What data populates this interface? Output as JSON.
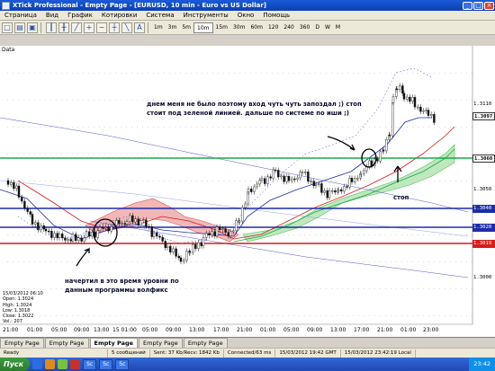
{
  "window": {
    "title": "XTick Professional - Empty Page - [EURUSD, 10 min - Euro vs US Dollar]",
    "minimize": "_",
    "maximize": "□",
    "close": "×"
  },
  "menu": [
    "Страница",
    "Вид",
    "График",
    "Котировки",
    "Система",
    "Инструменты",
    "Окно",
    "Помощь"
  ],
  "toolbar": {
    "timeframes": [
      "1m",
      "3m",
      "5m",
      "10m",
      "15m",
      "30m",
      "60m",
      "120",
      "240",
      "360",
      "D",
      "W",
      "M"
    ],
    "active_timeframe": "10m"
  },
  "chart": {
    "panel_label": "Data",
    "price_labels": [
      {
        "text": "1.3110",
        "style": "plain"
      },
      {
        "text": "1.3097",
        "style": "box"
      },
      {
        "text": "1.3060",
        "style": "box"
      },
      {
        "text": "1.3050",
        "style": "plain"
      },
      {
        "text": "1.3040",
        "style": "blue"
      },
      {
        "text": "1.3020",
        "style": "blue"
      },
      {
        "text": "1.3019",
        "style": "red"
      },
      {
        "text": "1.3000",
        "style": "plain"
      }
    ],
    "time_labels": [
      "21:00",
      "01:00",
      "05:00",
      "09:00",
      "13:00",
      "15 01:00",
      "05:00",
      "09:00",
      "13:00",
      "17:00",
      "21:00",
      "01:00",
      "05:00",
      "09:00",
      "13:00",
      "17:00",
      "21:00",
      "01:00",
      "23:00"
    ],
    "ohlc": {
      "date": "15/03/2012 06:10",
      "open": "Open: 1.3024",
      "high": "High: 1.3024",
      "low": "Low: 1.3018",
      "close": "Close: 1.3022",
      "vol": "Vol.: 207"
    },
    "annotations": {
      "top_line1": "днем меня не было поэтому вход чуть чуть запоздал ;) стоп",
      "top_line2": "стоит под зеленой линией. дальше по системе по иши ;)",
      "stop": "стоп",
      "bottom_line1": "начертил в это время уровни по",
      "bottom_line2": "данным программы волфикс"
    },
    "colors": {
      "green_level": "#1aa84b",
      "blue_level": "#1d2da7",
      "red_level": "#d81b1b",
      "candles": "#111111",
      "cloud_red": "#e05050",
      "cloud_green": "#4fbf4f"
    }
  },
  "tabs": [
    "Empty Page",
    "Empty Page",
    "Empty Page",
    "Empty Page",
    "Empty Page"
  ],
  "status": {
    "ready": "Ready",
    "messages": "5 сообщений",
    "sent": "Sent: 37 Kb/Recv: 1842 Kb",
    "connected": "Connected/63 ms",
    "gmt": "15/03/2012 19:42 GMT",
    "local": "15/03/2012 23:42:19 Local"
  },
  "taskbar": {
    "start": "Пуск",
    "tasks": [
      "Sc",
      "Sc",
      "Sc"
    ],
    "clock": "23:42"
  }
}
